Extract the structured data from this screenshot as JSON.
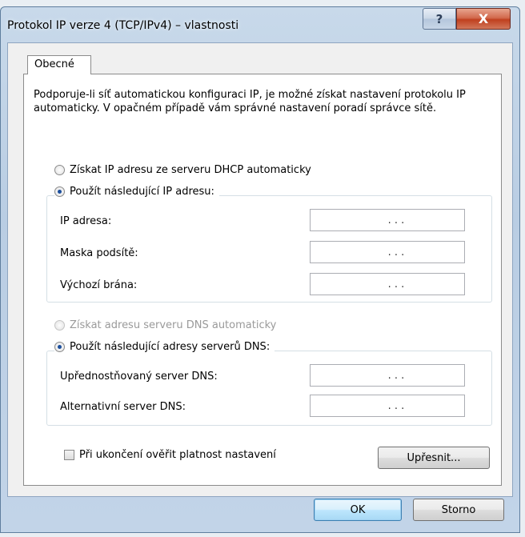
{
  "window": {
    "title": "Protokol IP verze 4 (TCP/IPv4) – vlastnosti",
    "help_glyph": "?",
    "close_glyph": "X"
  },
  "tabs": [
    {
      "label": "Obecné",
      "selected": true
    }
  ],
  "intro_text": "Podporuje-li síť automatickou konfiguraci IP, je možné získat nastavení protokolu IP automaticky. V opačném případě vám správné nastavení poradí správce sítě.",
  "ip_section": {
    "auto_option": {
      "label": "Získat IP adresu ze serveru DHCP automaticky",
      "checked": false,
      "enabled": true
    },
    "manual_option": {
      "label": "Použít následující IP adresu:",
      "checked": true,
      "enabled": true
    },
    "fields": [
      {
        "label": "IP adresa:",
        "value": ". . ."
      },
      {
        "label": "Maska podsítě:",
        "value": ". . ."
      },
      {
        "label": "Výchozí brána:",
        "value": ". . ."
      }
    ]
  },
  "dns_section": {
    "auto_option": {
      "label": "Získat adresu serveru DNS automaticky",
      "checked": false,
      "enabled": false
    },
    "manual_option": {
      "label": "Použít následující adresy serverů DNS:",
      "checked": true,
      "enabled": true
    },
    "fields": [
      {
        "label": "Upřednostňovaný server DNS:",
        "value": ". . ."
      },
      {
        "label": "Alternativní server DNS:",
        "value": ". . ."
      }
    ]
  },
  "validate_checkbox": {
    "label": "Při ukončení ověřit platnost nastavení",
    "checked": false
  },
  "buttons": {
    "advanced": "Upřesnit...",
    "ok": "OK",
    "cancel": "Storno"
  },
  "colors": {
    "title_bar": "#c2d4e8",
    "close_button": "#c0401f",
    "default_button_border": "#3c7fb1"
  }
}
